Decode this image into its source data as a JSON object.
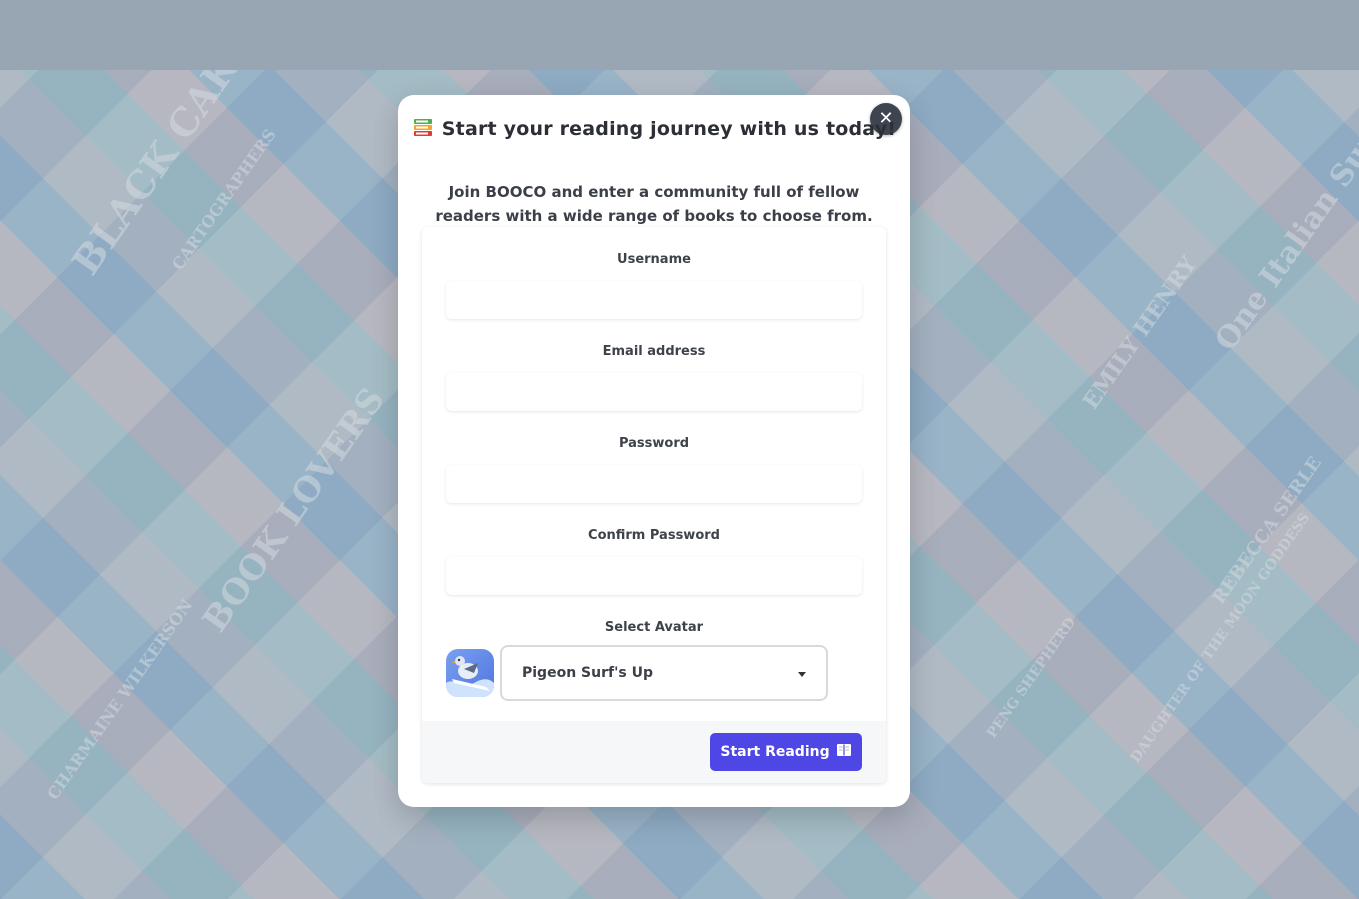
{
  "background": {
    "book_titles": [
      "BLACK CAKE",
      "BOOK LOVERS",
      "One Italian Summer",
      "CARTOGRAPHERS",
      "EMILY HENRY",
      "CHARMAINE WILKERSON",
      "REBECCA SERLE",
      "PENG SHEPHERD",
      "DAUGHTER OF THE MOON GODDESS"
    ]
  },
  "modal": {
    "title": "Start your reading journey with us today!",
    "title_icon": "books-icon",
    "intro": "Join BOOCO and enter a community full of fellow readers with a wide range of books to choose from.",
    "close_icon": "close-icon"
  },
  "form": {
    "username_label": "Username",
    "username_value": "",
    "email_label": "Email address",
    "email_value": "",
    "password_label": "Password",
    "password_value": "",
    "confirm_label": "Confirm Password",
    "confirm_value": "",
    "avatar_label": "Select Avatar",
    "avatar_selected": "Pigeon Surf's Up",
    "submit_label": "Start Reading",
    "submit_icon": "book-icon"
  },
  "colors": {
    "accent": "#4e46e5",
    "close_bg": "#3f4451"
  }
}
